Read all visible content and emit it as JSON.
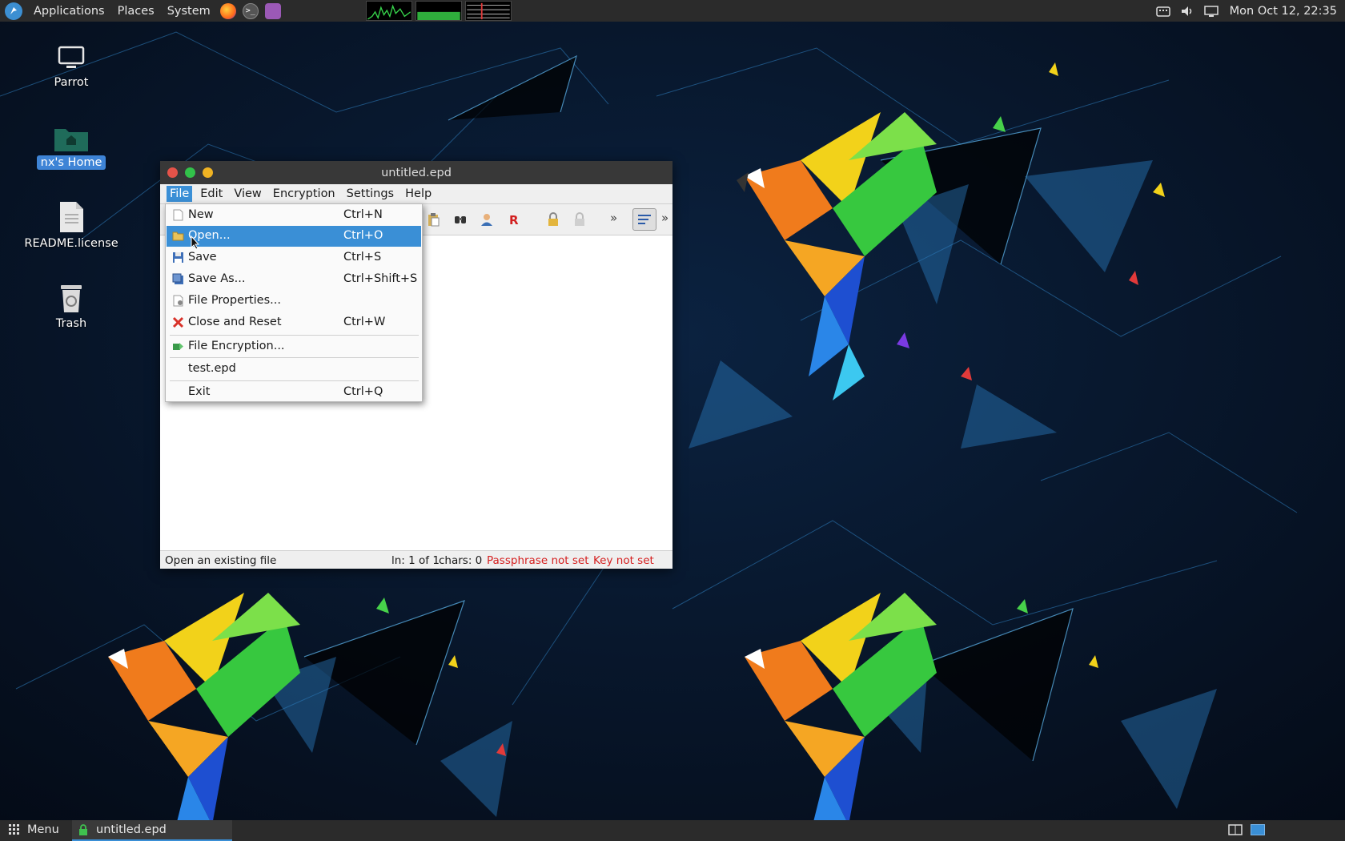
{
  "top_panel": {
    "menus": [
      "Applications",
      "Places",
      "System"
    ],
    "launchers": [
      "firefox-icon",
      "terminal-icon",
      "text-editor-icon"
    ],
    "clock": "Mon Oct 12, 22:35"
  },
  "desktop": {
    "icons": [
      {
        "label": "Parrot",
        "icon": "computer-icon"
      },
      {
        "label": "nx's Home",
        "icon": "home-folder-icon"
      },
      {
        "label": "README.license",
        "icon": "text-file-icon"
      },
      {
        "label": "Trash",
        "icon": "trash-icon"
      }
    ]
  },
  "window": {
    "title": "untitled.epd",
    "menubar": [
      "File",
      "Edit",
      "View",
      "Encryption",
      "Settings",
      "Help"
    ],
    "status": {
      "hint": "Open an existing file",
      "position": "ln: 1 of 1",
      "chars": "chars: 0",
      "passphrase": "Passphrase not set",
      "key": "Key not set"
    }
  },
  "file_menu": {
    "items": [
      {
        "label": "New",
        "accel": "Ctrl+N",
        "icon": "new-file-icon"
      },
      {
        "label": "Open...",
        "accel": "Ctrl+O",
        "icon": "open-folder-icon"
      },
      {
        "label": "Save",
        "accel": "Ctrl+S",
        "icon": "save-icon"
      },
      {
        "label": "Save As...",
        "accel": "Ctrl+Shift+S",
        "icon": "save-as-icon"
      },
      {
        "label": "File Properties...",
        "accel": "",
        "icon": "properties-icon"
      },
      {
        "label": "Close and Reset",
        "accel": "Ctrl+W",
        "icon": "close-red-icon"
      },
      {
        "label": "File Encryption...",
        "accel": "",
        "icon": "file-encryption-icon"
      },
      {
        "label": "test.epd",
        "accel": "",
        "icon": ""
      },
      {
        "label": "Exit",
        "accel": "Ctrl+Q",
        "icon": ""
      }
    ]
  },
  "bottom_panel": {
    "menu_label": "Menu",
    "task_label": "untitled.epd"
  }
}
